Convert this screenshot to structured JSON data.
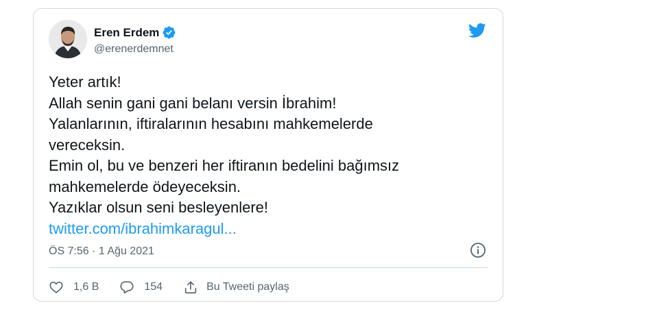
{
  "tweet": {
    "author": {
      "display_name": "Eren Erdem",
      "handle": "@erenerdemnet",
      "verified": true
    },
    "text_lines": [
      "Yeter artık!",
      "Allah senin gani gani belanı versin İbrahim!",
      "Yalanlarının, iftiralarının hesabını mahkemelerde",
      "vereceksin.",
      "Emin ol, bu ve benzeri her iftiranın bedelini bağımsız",
      "mahkemelerde ödeyeceksin.",
      "Yazıklar olsun seni besleyenlere!"
    ],
    "link_text": "twitter.com/ibrahimkaragul...",
    "timestamp": "ÖS 7:56 · 1 Ağu 2021",
    "like_count": "1,6 B",
    "reply_count": "154",
    "share_label": "Bu Tweeti paylaş"
  },
  "icons": {
    "brand": "twitter-bird-icon",
    "verified": "verified-badge-icon",
    "info": "info-icon",
    "like": "heart-icon",
    "reply": "comment-icon",
    "share": "share-icon"
  },
  "colors": {
    "accent": "#1d9bf0",
    "text": "#0f1419",
    "secondary_text": "#536471",
    "border": "#cfd9de"
  }
}
